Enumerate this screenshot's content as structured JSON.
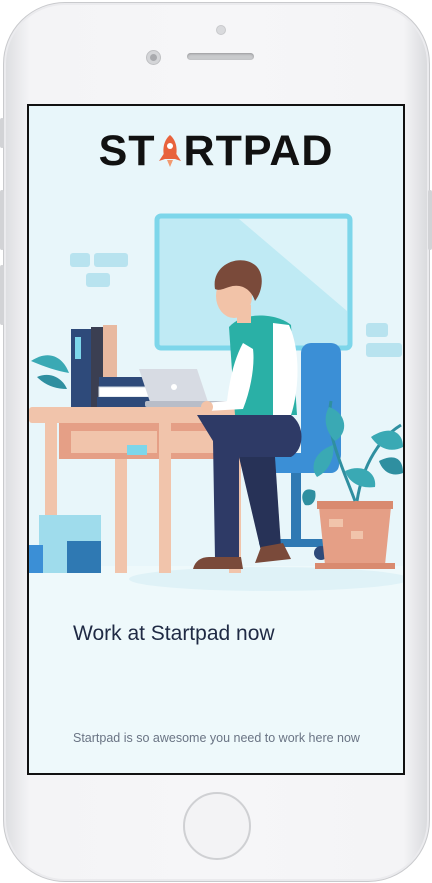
{
  "app": {
    "brand": "STARTPAD",
    "brand_left": "ST",
    "brand_right": "RTPAD",
    "logo_icon": "rocket-icon"
  },
  "hero": {
    "illustration": "person-working-at-desk-illustration"
  },
  "content": {
    "headline": "Work at Startpad now",
    "body": "Startpad is so awesome you need to work here now"
  },
  "colors": {
    "accent_rocket": "#e8623c",
    "teal": "#2ab0a6",
    "screen_bg": "#e8f6fa",
    "headline": "#1f2a44",
    "body": "#6a7484"
  }
}
